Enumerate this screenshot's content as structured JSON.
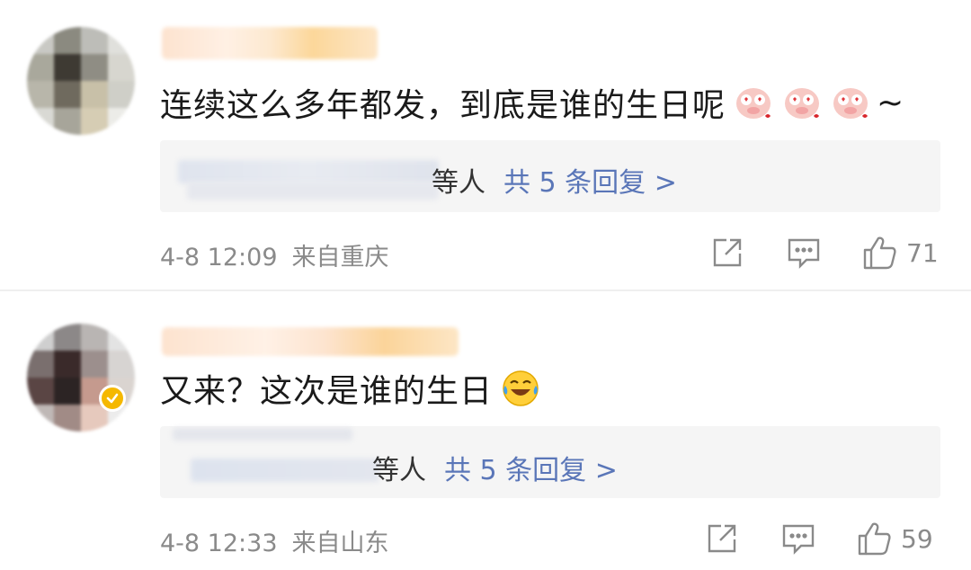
{
  "comments": [
    {
      "text": "连续这么多年都发，到底是谁的生日呢",
      "emoji_names": [
        "pig-heart-eyes-emoji",
        "pig-heart-eyes-emoji",
        "pig-heart-eyes-emoji"
      ],
      "text_suffix": "~",
      "reply_people": "等人",
      "reply_link": "共 5 条回复 >",
      "date": "4-8 12:09",
      "location": "来自重庆",
      "like_count": "71",
      "verified": false
    },
    {
      "text": "又来？这次是谁的生日",
      "emoji_names": [
        "laugh-cry-emoji"
      ],
      "text_suffix": "",
      "reply_people": "等人",
      "reply_link": "共 5 条回复 >",
      "date": "4-8 12:33",
      "location": "来自山东",
      "like_count": "59",
      "verified": true
    }
  ],
  "colors": {
    "link": "#5a76b8",
    "meta": "#8a8a8a",
    "reply_bg": "#f5f5f5",
    "verified": "#f5b800"
  },
  "icons": [
    "share-icon",
    "comment-icon",
    "like-icon"
  ]
}
